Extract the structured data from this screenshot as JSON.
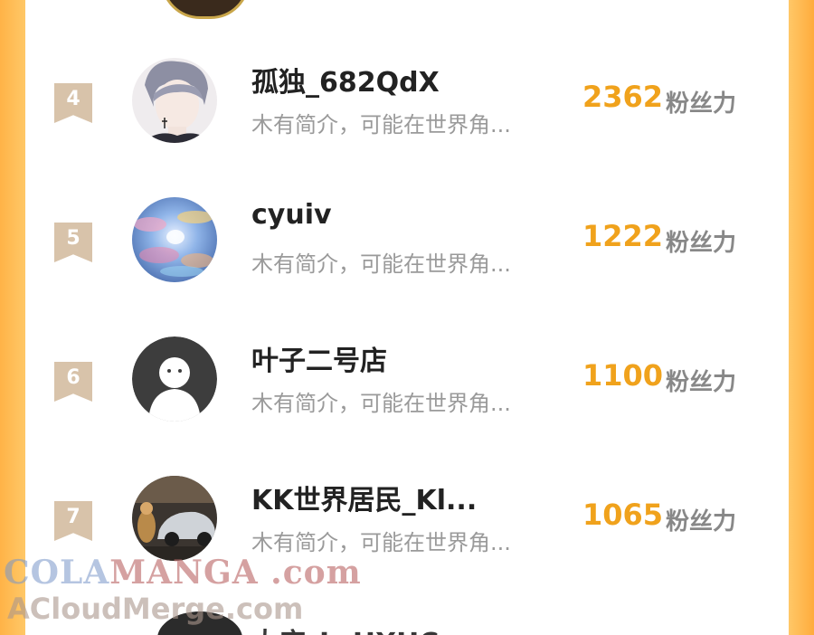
{
  "rows": [
    {
      "rank": "4",
      "name": "孤独_682QdX",
      "bio": "木有简介，可能在世界角...",
      "score": "2362",
      "unit": "粉丝力",
      "avatar": "anime-boy-avatar"
    },
    {
      "rank": "5",
      "name": "cyuiv",
      "bio": "木有简介，可能在世界角...",
      "score": "1222",
      "unit": "粉丝力",
      "avatar": "sky-clouds-avatar"
    },
    {
      "rank": "6",
      "name": "叶子二号店",
      "bio": "木有简介，可能在世界角...",
      "score": "1100",
      "unit": "粉丝力",
      "avatar": "default-ghost-avatar"
    },
    {
      "rank": "7",
      "name": "KK世界居民_Kl...",
      "bio": "木有简介，可能在世界角...",
      "score": "1065",
      "unit": "粉丝力",
      "avatar": "car-photo-avatar"
    }
  ],
  "partial_row": {
    "name": "大店_LcHXHC"
  },
  "watermark": {
    "line1_a": "COLA",
    "line1_b": "MANGA",
    "line1_c": " .com",
    "line2": "ACloudMerge.com"
  },
  "colors": {
    "score": "#f0a21c",
    "rank_badge": "#d8c3aa",
    "background": "#ffc766"
  }
}
